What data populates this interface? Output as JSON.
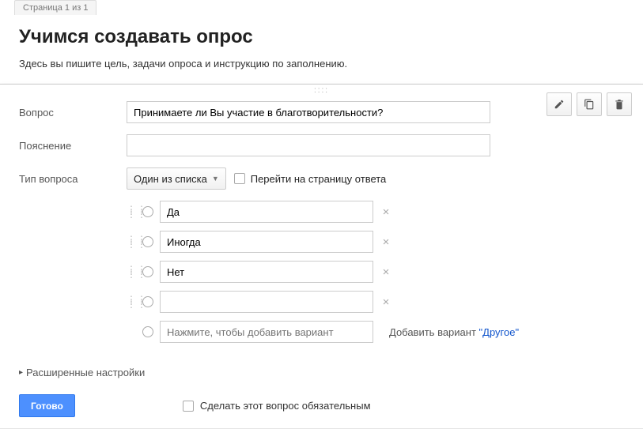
{
  "pageTab": "Страница 1 из 1",
  "title": "Учимся создавать опрос",
  "description": "Здесь вы пишите цель, задачи опроса и инструкцию по заполнению.",
  "labels": {
    "question": "Вопрос",
    "help": "Пояснение",
    "type": "Тип вопроса"
  },
  "question": {
    "text": "Принимаете ли Вы участие в благотворительности?",
    "help": "",
    "typeLabel": "Один из списка",
    "goToPage": "Перейти на страницу ответа"
  },
  "options": [
    {
      "text": "Да"
    },
    {
      "text": "Иногда"
    },
    {
      "text": "Нет"
    },
    {
      "text": ""
    }
  ],
  "addOption": {
    "placeholder": "Нажмите, чтобы добавить вариант",
    "otherPrefix": "Добавить вариант ",
    "otherLink": "\"Другое\""
  },
  "advanced": "Расширенные настройки",
  "footer": {
    "done": "Готово",
    "required": "Сделать этот вопрос обязательным"
  }
}
